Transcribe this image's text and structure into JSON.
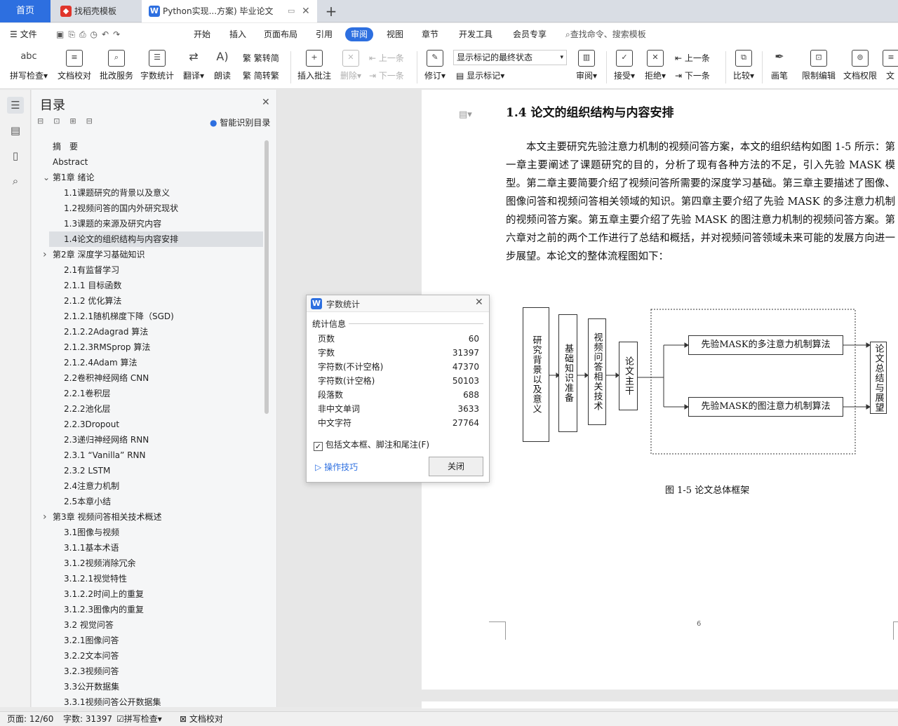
{
  "tabs": {
    "home": "首页",
    "template": "找稻壳模板",
    "document": "Python实现...方案) 毕业论文"
  },
  "menu": {
    "file": "文件",
    "items": [
      "开始",
      "插入",
      "页面布局",
      "引用",
      "审阅",
      "视图",
      "章节",
      "开发工具",
      "会员专享"
    ],
    "active": "审阅",
    "search": "查找命令、搜索模板"
  },
  "ribbon": {
    "spell_check": "拼写检查",
    "spell_icon_text": "abc",
    "doc_proof": "文档校对",
    "batch_service": "批改服务",
    "word_count": "字数统计",
    "translate": "翻译",
    "read_aloud": "朗读",
    "trad_convert": "繁转简",
    "simp_convert": "简转繁",
    "insert_comment": "插入批注",
    "delete": "删除",
    "prev_comment": "上一条",
    "next_comment": "下一条",
    "revise": "修订",
    "markup_state": "显示标记的最终状态",
    "show_markup": "显示标记",
    "review": "审阅",
    "accept": "接受",
    "reject": "拒绝",
    "prev_change": "上一条",
    "next_change": "下一条",
    "compare": "比较",
    "pen": "画笔",
    "restrict_edit": "限制编辑",
    "doc_permission": "文档权限",
    "doc_more": "文"
  },
  "toc": {
    "title": "目录",
    "smart": "智能识别目录",
    "items": [
      {
        "text": "摘　要",
        "level": 0
      },
      {
        "text": "Abstract",
        "level": 0
      },
      {
        "text": "第1章  绪论",
        "level": 0,
        "chevron": "down"
      },
      {
        "text": "1.1课题研究的背景以及意义",
        "level": 1
      },
      {
        "text": "1.2视频问答的国内外研究现状",
        "level": 1
      },
      {
        "text": "1.3课题的来源及研究内容",
        "level": 1
      },
      {
        "text": "1.4论文的组织结构与内容安排",
        "level": 1,
        "selected": true
      },
      {
        "text": "第2章  深度学习基础知识",
        "level": 0,
        "chevron": "right"
      },
      {
        "text": "2.1有监督学习",
        "level": 1
      },
      {
        "text": "2.1.1  目标函数",
        "level": 1
      },
      {
        "text": "2.1.2  优化算法",
        "level": 1
      },
      {
        "text": "2.1.2.1随机梯度下降（SGD)",
        "level": 1
      },
      {
        "text": "2.1.2.2Adagrad 算法",
        "level": 1
      },
      {
        "text": "2.1.2.3RMSprop 算法",
        "level": 1
      },
      {
        "text": "2.1.2.4Adam 算法",
        "level": 1
      },
      {
        "text": "2.2卷积神经网络  CNN",
        "level": 1
      },
      {
        "text": "2.2.1卷积层",
        "level": 1
      },
      {
        "text": "2.2.2池化层",
        "level": 1
      },
      {
        "text": "2.2.3Dropout",
        "level": 1
      },
      {
        "text": "2.3递归神经网络  RNN",
        "level": 1
      },
      {
        "text": "2.3.1  “Vanilla” RNN",
        "level": 1
      },
      {
        "text": "2.3.2  LSTM",
        "level": 1
      },
      {
        "text": "2.4注意力机制",
        "level": 1
      },
      {
        "text": "2.5本章小结",
        "level": 1
      },
      {
        "text": "第3章  视频问答相关技术概述",
        "level": 0,
        "chevron": "right"
      },
      {
        "text": "3.1图像与视频",
        "level": 1
      },
      {
        "text": "3.1.1基本术语",
        "level": 1
      },
      {
        "text": "3.1.2视频消除冗余",
        "level": 1
      },
      {
        "text": "3.1.2.1视觉特性",
        "level": 1
      },
      {
        "text": "3.1.2.2时间上的重复",
        "level": 1
      },
      {
        "text": "3.1.2.3图像内的重复",
        "level": 1
      },
      {
        "text": "3.2  视觉问答",
        "level": 1
      },
      {
        "text": "3.2.1图像问答",
        "level": 1
      },
      {
        "text": "3.2.2文本问答",
        "level": 1
      },
      {
        "text": "3.2.3视频问答",
        "level": 1
      },
      {
        "text": "3.3公开数据集",
        "level": 1
      },
      {
        "text": "3.3.1视频问答公开数据集",
        "level": 1
      }
    ]
  },
  "document": {
    "heading": "1.4   论文的组织结构与内容安排",
    "paragraph": "本文主要研究先验注意力机制的视频问答方案，本文的组织结构如图 1-5 所示：第一章主要阐述了课题研究的目的，分析了现有各种方法的不足，引入先验 MASK 模型。第二章主要简要介绍了视频问答所需要的深度学习基础。第三章主要描述了图像、图像问答和视频问答相关领域的知识。第四章主要介绍了先验 MASK 的多注意力机制的视频问答方案。第五章主要介绍了先验 MASK 的图注意力机制的视频问答方案。第六章对之前的两个工作进行了总结和概括，并对视频问答领域未来可能的发展方向进一步展望。本论文的整体流程图如下：",
    "diagram": {
      "box1": "研究背景以及意义",
      "box2": "基础知识准备",
      "box3": "视频问答相关技术",
      "box4": "论文主干",
      "box5": "先验MASK的多注意力机制算法",
      "box6": "先验MASK的图注意力机制算法",
      "box7": "论文总结与展望"
    },
    "caption": "图 1-5  论文总体框架",
    "page_number": "6"
  },
  "dialog": {
    "title": "字数统计",
    "section": "统计信息",
    "rows": [
      {
        "label": "页数",
        "value": "60"
      },
      {
        "label": "字数",
        "value": "31397"
      },
      {
        "label": "字符数(不计空格)",
        "value": "47370"
      },
      {
        "label": "字符数(计空格)",
        "value": "50103"
      },
      {
        "label": "段落数",
        "value": "688"
      },
      {
        "label": "非中文单词",
        "value": "3633"
      },
      {
        "label": "中文字符",
        "value": "27764"
      }
    ],
    "checkbox": "包括文本框、脚注和尾注(F)",
    "checked": true,
    "tips": "操作技巧",
    "close": "关闭"
  },
  "status": {
    "page": "页面: 12/60",
    "words": "字数: 31397",
    "spell": "拼写检查",
    "proof": "文档校对"
  },
  "colors": {
    "accent": "#2d6fe0",
    "selected": "#dcdfe3"
  }
}
